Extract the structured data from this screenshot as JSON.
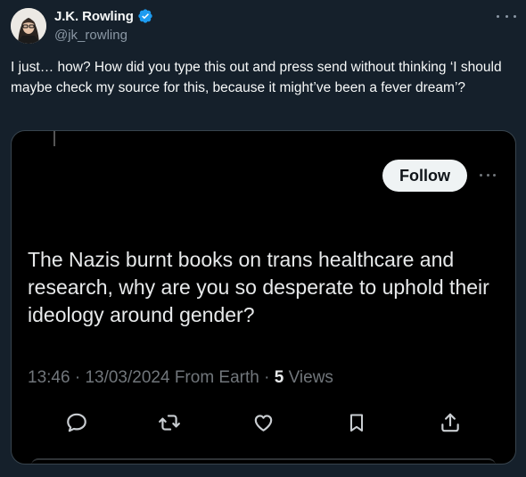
{
  "tweet": {
    "display_name": "J.K. Rowling",
    "handle": "@jk_rowling",
    "text": "I just… how? How did you type this out and press send without thinking ‘I should maybe check my source for this, because it might’ve been a fever dream’?"
  },
  "media": {
    "follow_label": "Follow",
    "quote_text": "The Nazis burnt books on trans healthcare and research, why are you so desperate to uphold their ideology around gender?",
    "time": "13:46",
    "date": "13/03/2024",
    "source": "From Earth",
    "views_count": "5",
    "views_label": "Views"
  },
  "icons": {
    "verified": "verified-badge-icon",
    "more": "more-dots-icon",
    "reply": "reply-icon",
    "retweet": "retweet-icon",
    "like": "like-icon",
    "bookmark": "bookmark-icon",
    "share": "share-icon"
  },
  "colors": {
    "background": "#15202b",
    "accent": "#1d9bf0",
    "muted": "#8b98a5",
    "media_background": "#000000"
  }
}
